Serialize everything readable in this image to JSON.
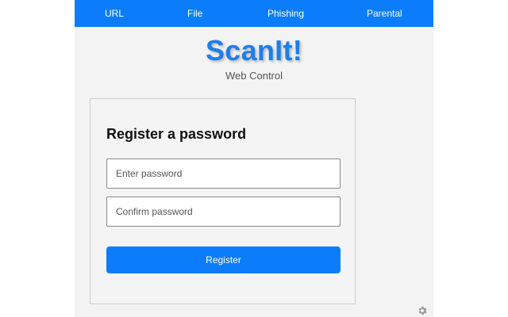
{
  "nav": {
    "tabs": [
      {
        "label": "URL"
      },
      {
        "label": "File"
      },
      {
        "label": "Phishing"
      },
      {
        "label": "Parental"
      }
    ]
  },
  "brand": {
    "title": "ScanIt!",
    "subtitle": "Web Control"
  },
  "form": {
    "heading": "Register a password",
    "password_placeholder": "Enter password",
    "password_value": "",
    "confirm_placeholder": "Confirm password",
    "confirm_value": "",
    "submit_label": "Register"
  },
  "icons": {
    "settings": "gear-icon"
  },
  "colors": {
    "accent": "#0b7dfa",
    "brand_title": "#1f7ee8",
    "background": "#f3f3f3"
  }
}
